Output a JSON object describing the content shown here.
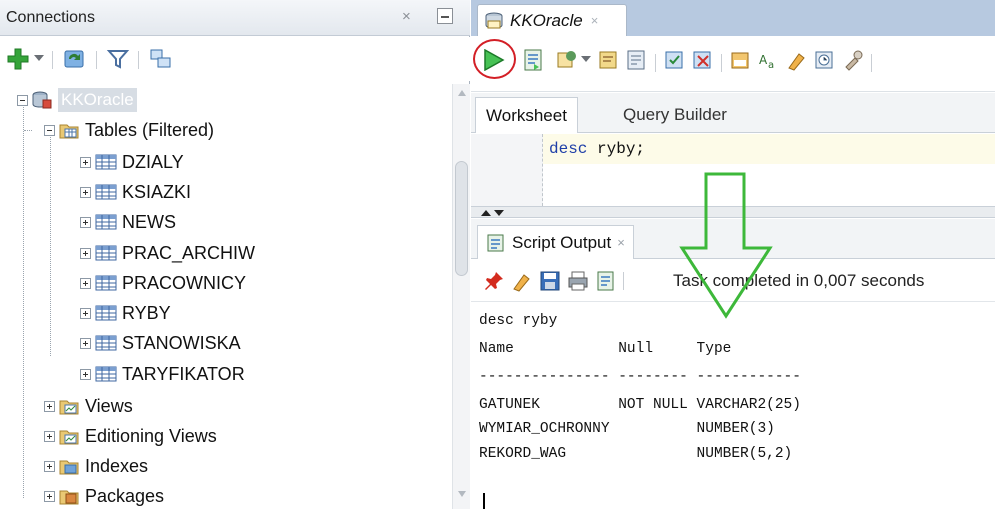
{
  "connections_panel": {
    "title": "Connections",
    "close_glyph": "×",
    "toolbar_icons": [
      "add-connection-icon",
      "dropdown-icon",
      "refresh-icon",
      "filter-icon",
      "schema-browser-icon"
    ]
  },
  "tree": {
    "connection": "KKOracle",
    "tables_folder": "Tables (Filtered)",
    "tables": [
      "DZIALY",
      "KSIAZKI",
      "NEWS",
      "PRAC_ARCHIW",
      "PRACOWNICY",
      "RYBY",
      "STANOWISKA",
      "TARYFIKATOR"
    ],
    "folders": [
      "Views",
      "Editioning Views",
      "Indexes",
      "Packages"
    ]
  },
  "document_tab": {
    "label": "KKOracle",
    "close_glyph": "×"
  },
  "worksheet": {
    "tabs": [
      "Worksheet",
      "Query Builder"
    ],
    "code_keyword": "desc",
    "code_rest": " ryby;"
  },
  "output_panel": {
    "tab_label": "Script Output",
    "close_glyph": "×",
    "status": "Task completed in 0,007 seconds",
    "lines": [
      "desc ryby",
      "Name            Null     Type",
      "--------------- -------- ------------",
      "GATUNEK         NOT NULL VARCHAR2(25)",
      "WYMIAR_OCHRONNY          NUMBER(3)",
      "REKORD_WAG               NUMBER(5,2)"
    ]
  },
  "colors": {
    "accent_tab_strip": "#b7c9e0",
    "run_highlight": "#d31f26",
    "annotation_arrow": "#3db83a"
  }
}
